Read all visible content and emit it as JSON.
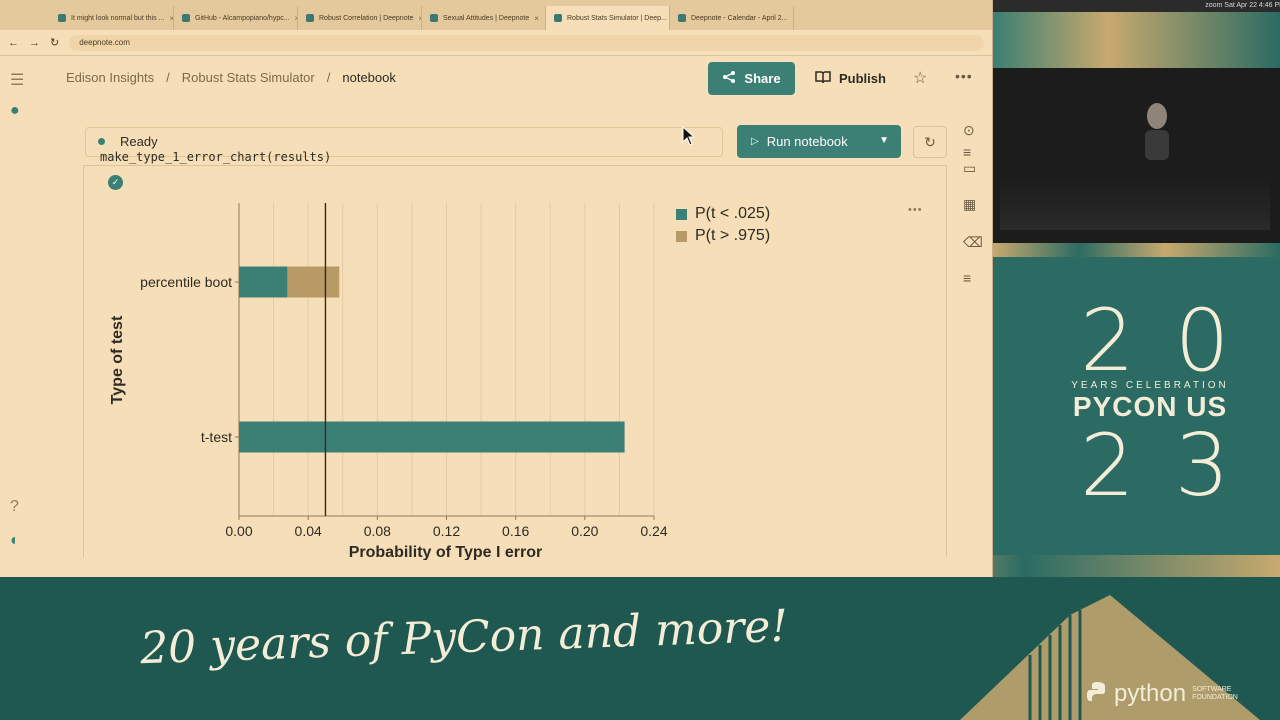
{
  "browser": {
    "tabs": [
      {
        "label": "It might look normal but this ..."
      },
      {
        "label": "GitHub - Alcampopiano/hypc..."
      },
      {
        "label": "Robust Correlation | Deepnote"
      },
      {
        "label": "Sexual Attitudes | Deepnote"
      },
      {
        "label": "Robust Stats Simulator | Deep..."
      },
      {
        "label": "Deepnote - Calendar - April 2..."
      }
    ],
    "url": "deepnote.com",
    "os_status": "zoom   Sat Apr 22  4:46 PM"
  },
  "app": {
    "breadcrumb": [
      "Edison Insights",
      "/",
      "Robust Stats Simulator",
      "/",
      "notebook"
    ],
    "share_label": "Share",
    "publish_label": "Publish",
    "status": "Ready",
    "run_label": "Run notebook",
    "code_line": "make_type_1_error_chart(results)"
  },
  "colors": {
    "accent": "#3c7f75",
    "series_lower": "#3c7f75",
    "series_upper": "#b89a66",
    "background": "#f6dfb8"
  },
  "chart_data": {
    "type": "bar",
    "orientation": "horizontal",
    "stacked": true,
    "categories": [
      "percentile boot",
      "t-test"
    ],
    "series": [
      {
        "name": "P(t < .025)",
        "values": [
          0.028,
          0.223
        ]
      },
      {
        "name": "P(t > .975)",
        "values": [
          0.03,
          0.0
        ]
      }
    ],
    "reference_line": 0.05,
    "xlabel": "Probability of Type I error",
    "ylabel": "Type of test",
    "xlim": [
      0,
      0.24
    ],
    "xticks": [
      "0.00",
      "0.04",
      "0.08",
      "0.12",
      "0.16",
      "0.20",
      "0.24"
    ],
    "grid": "vertical",
    "legend": "top-right"
  },
  "conference": {
    "pycon_top": "20",
    "pycon_years": "YEARS CELEBRATION",
    "pycon_us": "PYCON US",
    "pycon_bottom": "23",
    "tagline": "20 years of PyCon and more!",
    "psf_word": "python",
    "psf_sub_1": "SOFTWARE",
    "psf_sub_2": "FOUNDATION"
  }
}
